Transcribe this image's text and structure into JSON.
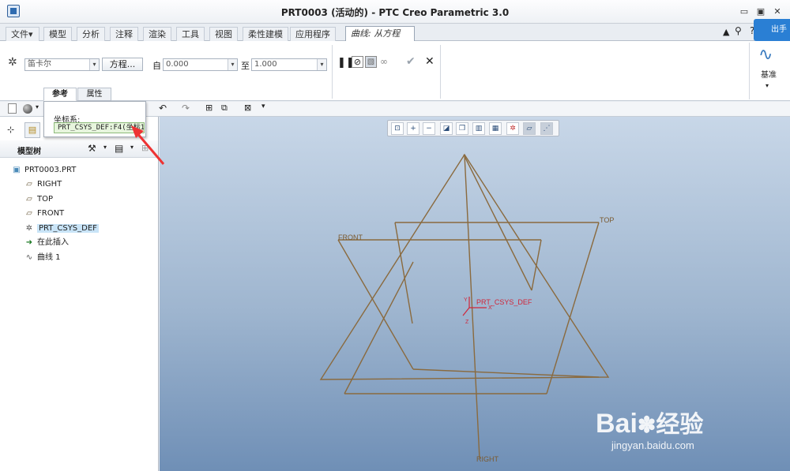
{
  "window": {
    "title": "PRT0003 (活动的) - PTC Creo Parametric 3.0",
    "min": "▭",
    "restore": "▣",
    "close": "✕"
  },
  "menu_tabs": [
    {
      "label": "文件"
    },
    {
      "label": "模型"
    },
    {
      "label": "分析"
    },
    {
      "label": "注释"
    },
    {
      "label": "渲染"
    },
    {
      "label": "工具"
    },
    {
      "label": "视图"
    },
    {
      "label": "柔性建模"
    },
    {
      "label": "应用程序"
    },
    {
      "label": "曲线: 从方程"
    }
  ],
  "menu_dropdown_arrow": "▾",
  "ribbon": {
    "coord_type": "笛卡尔",
    "equation_button": "方程...",
    "from_label": "自",
    "from_value": "0.000",
    "to_label": "至",
    "to_value": "1.000",
    "datum_label": "基准"
  },
  "subtabs": [
    {
      "label": "参考"
    },
    {
      "label": "属性"
    }
  ],
  "popup": {
    "label": "坐标系:",
    "value": "PRT_CSYS_DEF:F4(坐标1"
  },
  "model_tree": {
    "header": "模型树",
    "root": "PRT0003.PRT",
    "items": [
      {
        "label": "RIGHT",
        "icon": "plane-icon"
      },
      {
        "label": "TOP",
        "icon": "plane-icon"
      },
      {
        "label": "FRONT",
        "icon": "plane-icon"
      },
      {
        "label": "PRT_CSYS_DEF",
        "icon": "csys-icon"
      },
      {
        "label": "在此插入",
        "icon": "insert-arrow-icon"
      },
      {
        "label": "曲线 1",
        "icon": "curve-icon"
      }
    ]
  },
  "viewport": {
    "plane_labels": {
      "front": "FRONT",
      "top": "TOP",
      "right": "RIGHT"
    },
    "csys_label": "PRT_CSYS_DEF",
    "axis_x": "X",
    "axis_y": "Y",
    "axis_z": "Z"
  },
  "watermark": {
    "brand": "Bai",
    "brand2": "经验",
    "url": "jingyan.baidu.com"
  },
  "top_right_label": "出手",
  "colors": {
    "accent": "#2f6bb0",
    "datum_plane": "#8a6a3e",
    "csys": "#d0263a",
    "highlight": "#c9e4f7"
  }
}
